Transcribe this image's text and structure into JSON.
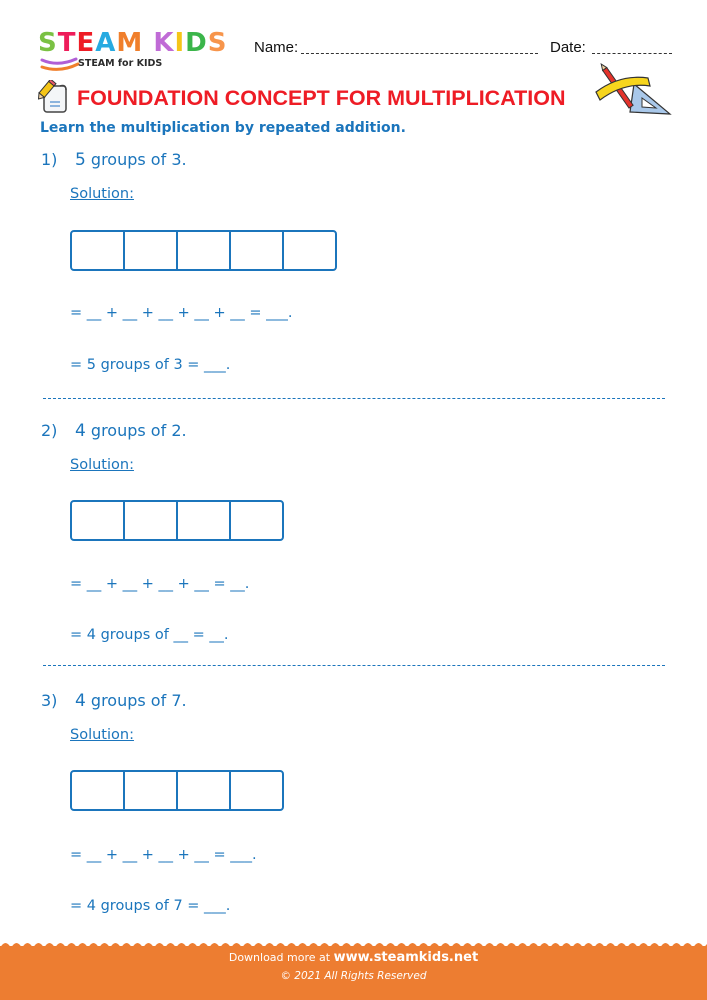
{
  "header": {
    "logo": {
      "letters": [
        {
          "ch": "S",
          "color": "#7ac143"
        },
        {
          "ch": "T",
          "color": "#ee1c5a"
        },
        {
          "ch": "E",
          "color": "#ee1c25"
        },
        {
          "ch": "A",
          "color": "#27aae1"
        },
        {
          "ch": "M",
          "color": "#f07f2c"
        },
        {
          "ch": " ",
          "color": "#ffffff"
        },
        {
          "ch": "K",
          "color": "#c06bd6"
        },
        {
          "ch": "I",
          "color": "#f5c518"
        },
        {
          "ch": "D",
          "color": "#3bb54a"
        },
        {
          "ch": "S",
          "color": "#f7954b"
        }
      ],
      "tagline": "STEAM for KIDS"
    },
    "name_label": "Name:",
    "date_label": "Date:",
    "title": "FOUNDATION CONCEPT FOR MULTIPLICATION",
    "title_icon": "pencil-paper-icon",
    "tools_icon": "ruler-pencil-triangle-icon"
  },
  "instruction": "Learn the multiplication by repeated addition.",
  "questions": [
    {
      "number": "1)",
      "prompt_num": "5",
      "prompt_rest": " groups of 3.",
      "solution_label": "Solution:",
      "box_count": 5,
      "equation1": "= __ + __ + __ + __ + __ = ___.",
      "equation2": "= 5 groups of 3 = ___."
    },
    {
      "number": "2)",
      "prompt_num": "4",
      "prompt_rest": " groups of 2.",
      "solution_label": "Solution:",
      "box_count": 4,
      "equation1": "= __ + __ + __ + __ = __.",
      "equation2": "= 4 groups of __ = __."
    },
    {
      "number": "3)",
      "prompt_num": "4",
      "prompt_rest": " groups of 7.",
      "solution_label": "Solution:",
      "box_count": 4,
      "equation1": "= __ + __ + __ + __ = ___.",
      "equation2": "= 4 groups of 7 = ___."
    }
  ],
  "footer": {
    "download_prefix": "Download more at ",
    "site": "www.steamkids.net",
    "copyright": "© 2021 All Rights Reserved",
    "color": "#ed7d31"
  }
}
